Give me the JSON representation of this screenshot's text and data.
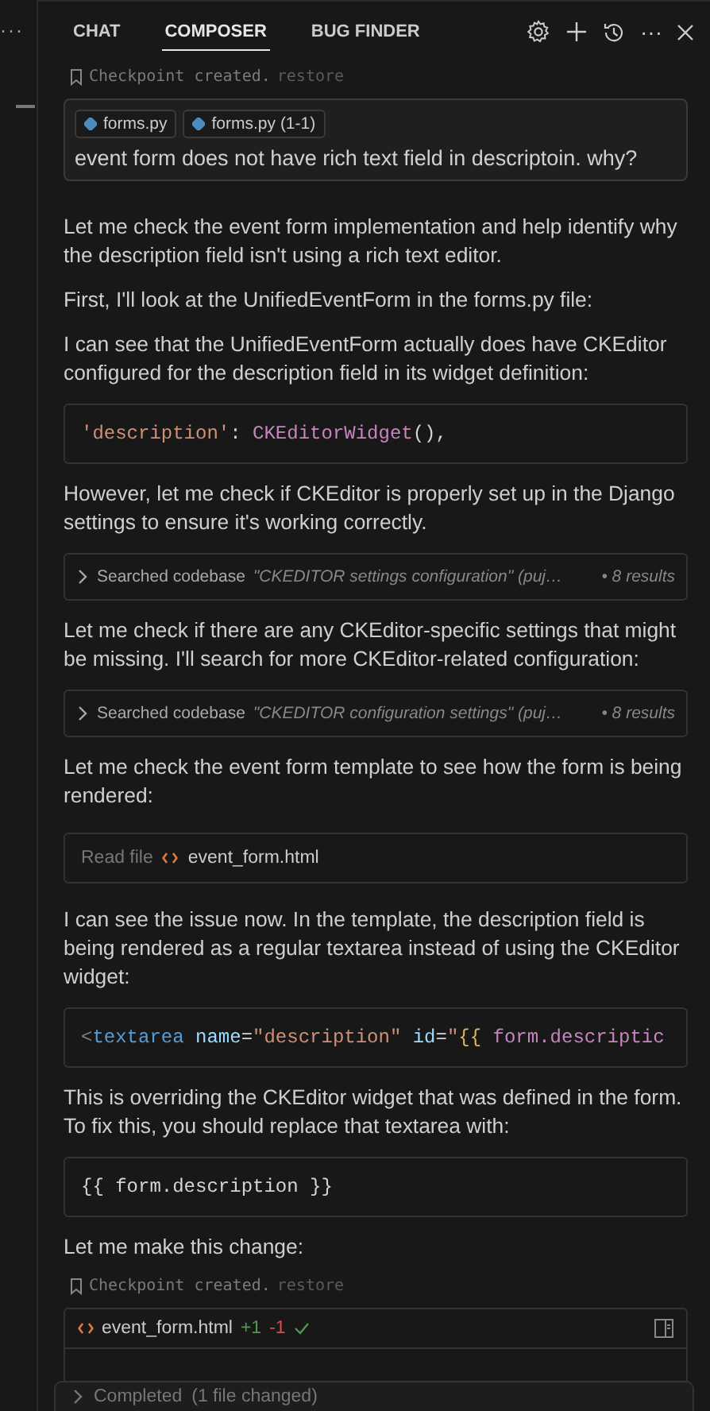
{
  "left_strip": {
    "more": "···"
  },
  "tabs": [
    {
      "label": "CHAT",
      "selected": false
    },
    {
      "label": "COMPOSER",
      "selected": true
    },
    {
      "label": "BUG FINDER",
      "selected": false
    }
  ],
  "toolbar": {
    "more": "···"
  },
  "messages": [
    {
      "kind": "checkpoint",
      "text": "Checkpoint created.",
      "action": "restore"
    },
    {
      "kind": "user",
      "chips": [
        "forms.py",
        "forms.py (1-1)"
      ],
      "text": "event form does not have rich text field in descriptoin. why?"
    },
    {
      "kind": "text",
      "text": "Let me check the event form implementation and help identify why the description field isn't using a rich text editor."
    },
    {
      "kind": "text",
      "text": "First, I'll look at the UnifiedEventForm in the forms.py file:"
    },
    {
      "kind": "text",
      "text": "I can see that the UnifiedEventForm actually does have CKEditor configured for the description field in its widget definition:"
    },
    {
      "kind": "code",
      "tokens": [
        {
          "kind": "string",
          "text": "'description'"
        },
        {
          "kind": "plain",
          "text": ":"
        },
        {
          "kind": "func",
          "text": " CKEditorWidget"
        },
        {
          "kind": "plain",
          "text": "(),"
        }
      ]
    },
    {
      "kind": "text",
      "text": "However, let me check if CKEditor is properly set up in the Django settings to ensure it's working correctly."
    },
    {
      "kind": "search",
      "label": "Searched codebase",
      "query": "\"CKEDITOR settings configuration\" (puj…",
      "results": "• 8 results",
      "expanded": false
    },
    {
      "kind": "text",
      "text": "Let me check if there are any CKEditor-specific settings that might be missing. I'll search for more CKEditor-related configuration:"
    },
    {
      "kind": "search",
      "label": "Searched codebase",
      "query": "\"CKEDITOR configuration settings\" (puj…",
      "results": "• 8 results",
      "expanded": false
    },
    {
      "kind": "text",
      "text": "Let me check the event form template to see how the form is being rendered:"
    },
    {
      "kind": "read",
      "label": "Read file",
      "file": "event_form.html"
    },
    {
      "kind": "text",
      "text": "I can see the issue now. In the template, the description field is being rendered as a regular textarea instead of using the CKEditor widget:"
    },
    {
      "kind": "code",
      "tokens": [
        {
          "kind": "punct",
          "text": "<"
        },
        {
          "kind": "tag",
          "text": "textarea"
        },
        {
          "kind": "attr",
          "text": " name"
        },
        {
          "kind": "plain",
          "text": "="
        },
        {
          "kind": "string",
          "text": "\"description\""
        },
        {
          "kind": "attr",
          "text": " id"
        },
        {
          "kind": "plain",
          "text": "="
        },
        {
          "kind": "string",
          "text": "\""
        },
        {
          "kind": "brace",
          "text": "{{"
        },
        {
          "kind": "var",
          "text": " form.descriptic"
        }
      ]
    },
    {
      "kind": "text",
      "text": "This is overriding the CKEditor widget that was defined in the form. To fix this, you should replace that textarea with:"
    },
    {
      "kind": "code",
      "tokens": [
        {
          "kind": "plain",
          "text": "{{ form.description }}"
        }
      ]
    },
    {
      "kind": "text",
      "text": "Let me make this change:"
    },
    {
      "kind": "checkpoint",
      "text": "Checkpoint created.",
      "action": "restore"
    },
    {
      "kind": "diff",
      "file": "event_form.html",
      "added": "+1",
      "removed": "-1"
    }
  ],
  "footer": {
    "text": "Completed",
    "detail": "(1 file changed)",
    "expanded": false
  }
}
